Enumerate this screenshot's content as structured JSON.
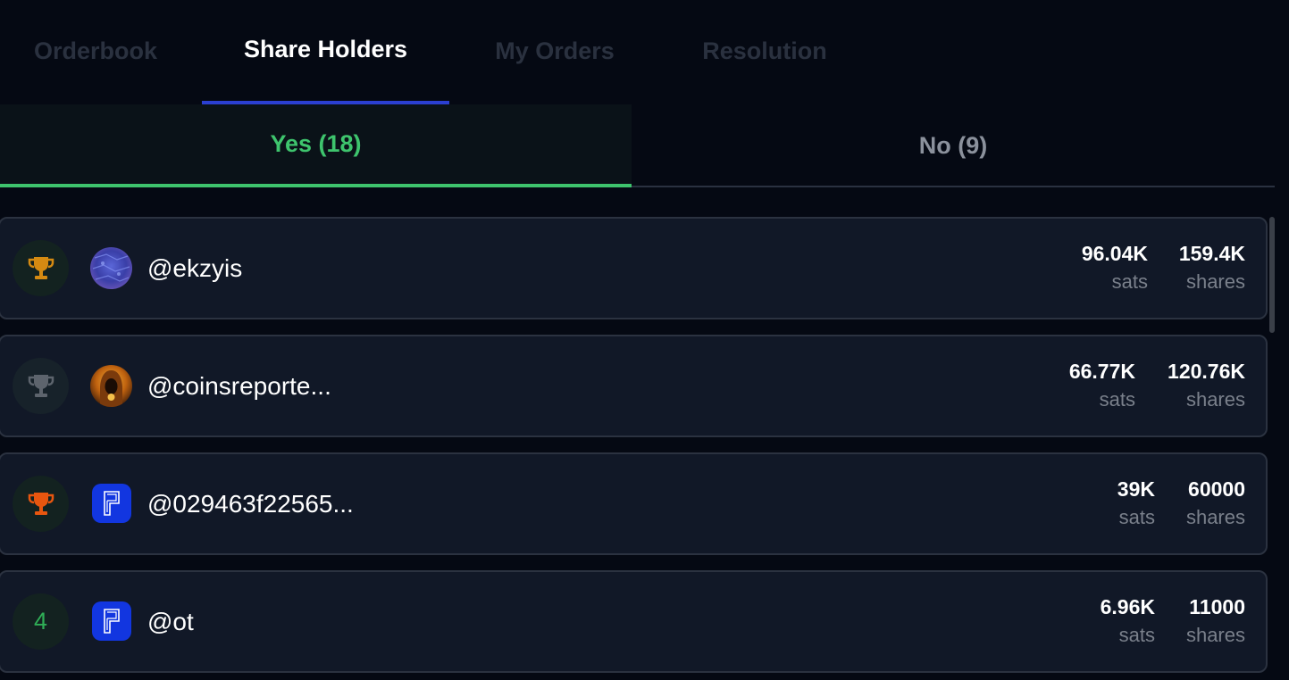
{
  "tabs": {
    "orderbook": "Orderbook",
    "share_holders": "Share Holders",
    "my_orders": "My Orders",
    "resolution": "Resolution",
    "active": "share_holders"
  },
  "subtabs": {
    "yes": "Yes (18)",
    "no": "No (9)",
    "active": "yes"
  },
  "holders": [
    {
      "rank_icon": "trophy-gold-icon",
      "rank": "",
      "avatar": "blue-pattern-avatar",
      "username": "@ekzyis",
      "sats": "96.04K",
      "sats_unit": "sats",
      "shares": "159.4K",
      "shares_unit": "shares",
      "trophy_color": "#d58a12"
    },
    {
      "rank_icon": "trophy-silver-icon",
      "rank": "",
      "avatar": "hooded-figure-avatar",
      "username": "@coinsreporte...",
      "sats": "66.77K",
      "sats_unit": "sats",
      "shares": "120.76K",
      "shares_unit": "shares",
      "trophy_color": "#5d646d"
    },
    {
      "rank_icon": "trophy-bronze-icon",
      "rank": "",
      "avatar": "p-logo-avatar",
      "username": "@029463f22565...",
      "sats": "39K",
      "sats_unit": "sats",
      "shares": "60000",
      "shares_unit": "shares",
      "trophy_color": "#e8560f"
    },
    {
      "rank_icon": "",
      "rank": "4",
      "avatar": "p-logo-avatar",
      "username": "@ot",
      "sats": "6.96K",
      "sats_unit": "sats",
      "shares": "11000",
      "shares_unit": "shares",
      "trophy_color": ""
    }
  ],
  "colors": {
    "background": "#050913",
    "card": "#111827",
    "accent_blue": "#2b3fd1",
    "yes_green": "#3ec46d",
    "avatar_blue": "#1236e0"
  }
}
